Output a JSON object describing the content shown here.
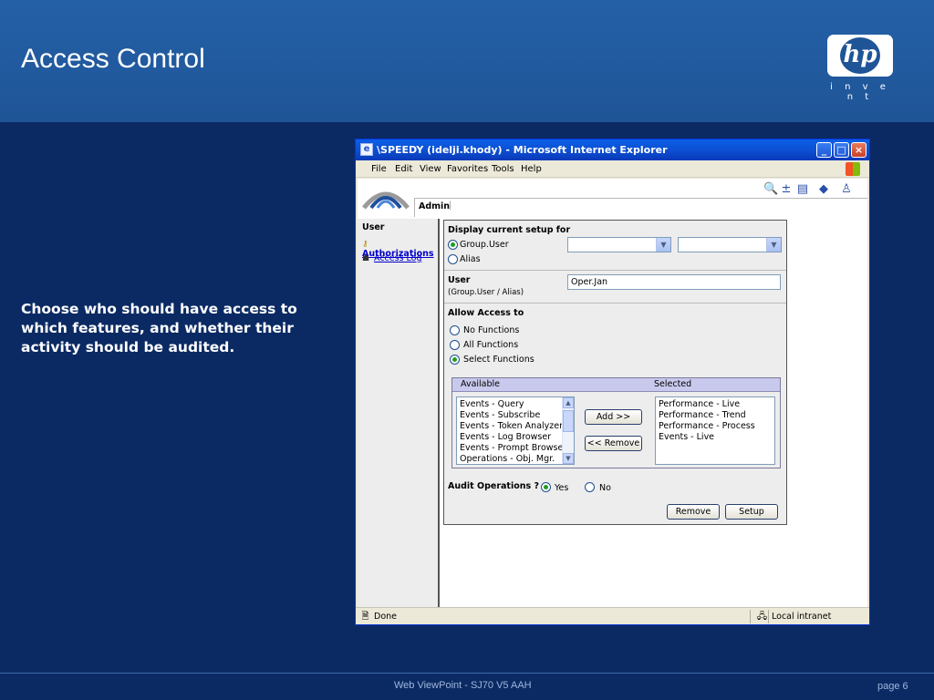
{
  "slide": {
    "title": "Access Control",
    "logo_text": "hp",
    "logo_tagline": "i n v e n t",
    "description": "Choose who should have access to which features, and whether their activity should be audited.",
    "footer_center": "Web ViewPoint - SJ70 V5 AAH",
    "footer_page": "page 6"
  },
  "window": {
    "title": "\\SPEEDY (idelji.khody) - Microsoft Internet Explorer",
    "menu": [
      "File",
      "Edit",
      "View",
      "Favorites",
      "Tools",
      "Help"
    ],
    "status_left": "Done",
    "status_right": "Local intranet"
  },
  "app": {
    "tab_label": "Admin",
    "tab_separator": "|",
    "nav_header": "User",
    "nav_items": [
      {
        "label": "Authorizations",
        "icon": "key-icon"
      },
      {
        "label": "Access Log",
        "icon": "people-icon"
      }
    ]
  },
  "form": {
    "display_setup_label": "Display current setup for",
    "option_group_user": "Group.User",
    "option_alias": "Alias",
    "selected_setup": "Group.User",
    "user_label": "User",
    "user_hint": "(Group.User / Alias)",
    "user_value": "Oper.Jan",
    "allow_label": "Allow Access to",
    "allow_options": [
      "No Functions",
      "All Functions",
      "Select Functions"
    ],
    "allow_selected": "Select Functions",
    "available_header": "Available",
    "selected_header": "Selected",
    "available_items": [
      "Events - Query",
      "Events - Subscribe",
      "Events - Token Analyzer",
      "Events - Log Browser",
      "Events - Prompt Browser",
      "Operations - Obj. Mgr."
    ],
    "selected_items": [
      "Performance - Live",
      "Performance - Trend",
      "Performance - Process",
      "Events - Live"
    ],
    "add_button": "Add >>",
    "remove_list_button": "<< Remove",
    "audit_label": "Audit Operations ?",
    "audit_yes": "Yes",
    "audit_no": "No",
    "audit_selected": "Yes",
    "remove_button": "Remove",
    "setup_button": "Setup"
  },
  "colors": {
    "slide_background": "#0b2a63",
    "header_background": "#2460a7",
    "titlebar": "#0a5fe6",
    "link": "#0000cc",
    "radio_selected": "#1f9d23"
  }
}
